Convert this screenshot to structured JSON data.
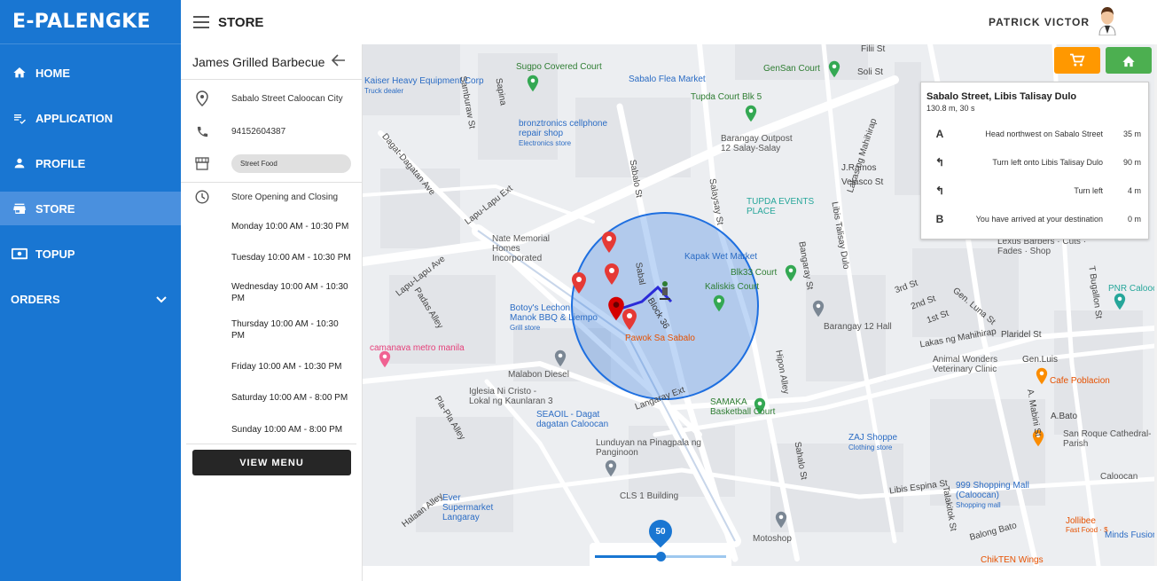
{
  "app": {
    "brand": "E-PALENGKE",
    "page_title": "STORE",
    "user_name": "PATRICK VICTOR"
  },
  "sidebar": {
    "items": [
      {
        "label": "HOME",
        "icon": "home-icon"
      },
      {
        "label": "APPLICATION",
        "icon": "playlist-check-icon"
      },
      {
        "label": "PROFILE",
        "icon": "person-icon"
      },
      {
        "label": "STORE",
        "icon": "store-icon",
        "active": true
      },
      {
        "label": "TOPUP",
        "icon": "money-icon"
      },
      {
        "label": "ORDERS",
        "icon": "chevron-down-icon"
      }
    ]
  },
  "store": {
    "name": "James Grilled Barbecue",
    "address": "Sabalo Street Caloocan City",
    "phone": "94152604387",
    "category": "Street Food",
    "hours_label": "Store Opening and Closing",
    "hours": [
      "Monday 10:00 AM - 10:30 PM",
      "Tuesday 10:00 AM - 10:30 PM",
      "Wednesday 10:00 AM - 10:30 PM",
      "Thursday 10:00 AM - 10:30 PM",
      "Friday 10:00 AM - 10:30 PM",
      "Saturday 10:00 AM - 8:00 PM",
      "Sunday 10:00 AM - 8:00 PM"
    ],
    "view_menu_label": "VIEW MENU"
  },
  "directions": {
    "title": "Sabalo Street, Libis Talisay Dulo",
    "summary": "130.8 m, 30 s",
    "steps": [
      {
        "symbol": "A",
        "text": "Head northwest on Sabalo Street",
        "distance": "35 m"
      },
      {
        "symbol": "↰",
        "text": "Turn left onto Libis Talisay Dulo",
        "distance": "90 m"
      },
      {
        "symbol": "↰",
        "text": "Turn left",
        "distance": "4 m"
      },
      {
        "symbol": "B",
        "text": "You have arrived at your destination",
        "distance": "0 m"
      }
    ]
  },
  "radius_slider": {
    "value": 50,
    "fraction": 0.5
  },
  "map_labels": {
    "places": [
      "Kaiser Heavy Equipment Corp",
      "Truck dealer",
      "Sugpo Covered Court",
      "Sabalo Flea Market",
      "GenSan Court",
      "Tupda Court Blk 5",
      "bronztronics cellphone repair shop",
      "Electronics store",
      "Barangay Outpost 12 Salay-Salay",
      "TUPDA EVENTS PLACE",
      "Nate Memorial Homes Incorporated",
      "Kapak Wet Market",
      "Blk33 Court",
      "Kaliskis Court",
      "Botoy's Lechon Manok BBQ & Liempo",
      "Grill store",
      "Pawok Sa Sabalo",
      "Barangay 12 Hall",
      "camanava metro manila",
      "Malabon Diesel",
      "Iglesia Ni Cristo - Lokal ng Kaunlaran 3",
      "SEAOIL - Dagat dagatan Caloocan",
      "SAMAKA Basketball Court",
      "Lunduyan na Pinagpala ng Panginoon",
      "CLS 1 Building",
      "Ever Supermarket Langaray",
      "Motoshop",
      "ZAJ Shoppe",
      "Clothing store",
      "999 Shopping Mall (Caloocan)",
      "Shopping mall",
      "Animal Wonders Veterinary Clinic",
      "Cafe Poblacion",
      "San Roque Cathedral-Parish",
      "Lexus Barbers · Cuts · Fades · Shop",
      "PNR Caloocan",
      "Jollibee",
      "Fast Food · $",
      "Minds Fusion",
      "ChikTEN Wings",
      "Caloocan"
    ],
    "streets": [
      "Sabalo St",
      "Samburaw St",
      "Dagat-Dagatan Ave",
      "Lapu-Lapu Ext",
      "Lapu-Lapu Ave",
      "Padas Alley",
      "Pla-Pla Alley",
      "Salaysay St",
      "Langaray Ext",
      "Lakas ng Mahihirap",
      "Libis Talisay Dulo",
      "Bangaray St",
      "Hipon Alley",
      "Lakas ng Mahihirap",
      "3rd St",
      "2nd St",
      "1st St",
      "Gen. Luna St",
      "Plaridel St",
      "A. Mabini St",
      "T Bugallon St",
      "J.Ramos",
      "Velasco St",
      "Libis Espina St",
      "Talakitok St",
      "Balong Bato",
      "Halaan Alley",
      "Filii St",
      "Soli St",
      "Block 36",
      "Gen.Luis",
      "A.Bato",
      "Sapina",
      "Sahalo St",
      "Sabal"
    ]
  },
  "colors": {
    "primary": "#1976d2",
    "sidebar_active": "#4a90de",
    "cart": "#ff9800",
    "home": "#4caf50",
    "route": "#2b2bd8",
    "radius": "#1e6fe0"
  }
}
